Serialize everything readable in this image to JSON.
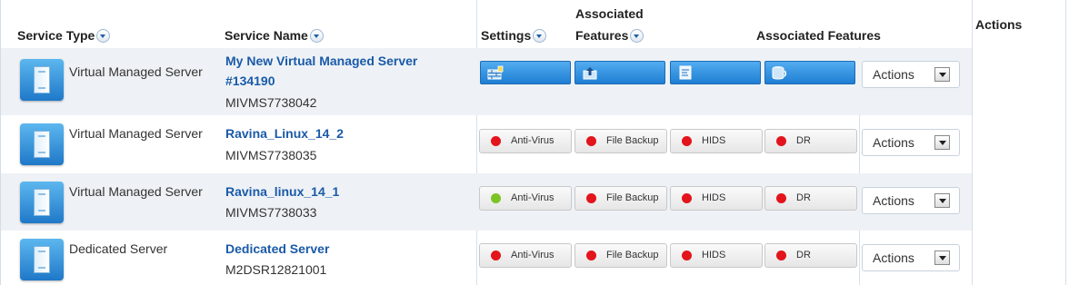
{
  "header": {
    "service_type": "Service Type",
    "service_name": "Service Name",
    "settings": "Settings",
    "associated_features_1": "Associated",
    "associated_features_2": "Features",
    "associated_features_full": "Associated Features",
    "actions": "Actions"
  },
  "rows": [
    {
      "type": "Virtual Managed Server",
      "name_line1": "My New Virtual Managed Server",
      "name_line2": "#134190",
      "code": "MIVMS7738042",
      "action": "Actions"
    },
    {
      "type": "Virtual Managed Server",
      "name_line1": "Ravina_Linux_14_2",
      "code": "MIVMS7738035",
      "action": "Actions",
      "features": [
        {
          "label": "Anti-Virus",
          "status": "red"
        },
        {
          "label": "File Backup",
          "status": "red"
        },
        {
          "label": "HIDS",
          "status": "red"
        },
        {
          "label": "DR",
          "status": "red"
        }
      ]
    },
    {
      "type": "Virtual Managed Server",
      "name_line1": "Ravina_linux_14_1",
      "code": "MIVMS7738033",
      "action": "Actions",
      "features": [
        {
          "label": "Anti-Virus",
          "status": "green"
        },
        {
          "label": "File Backup",
          "status": "red"
        },
        {
          "label": "HIDS",
          "status": "red"
        },
        {
          "label": "DR",
          "status": "red"
        }
      ]
    },
    {
      "type": "Dedicated Server",
      "name_line1": "Dedicated Server",
      "code": "M2DSR12821001",
      "action": "Actions",
      "features": [
        {
          "label": "Anti-Virus",
          "status": "red"
        },
        {
          "label": "File Backup",
          "status": "red"
        },
        {
          "label": "HIDS",
          "status": "red"
        },
        {
          "label": "DR",
          "status": "red"
        }
      ]
    }
  ],
  "colors": {
    "red": "#e3141b",
    "green": "#7cc425"
  },
  "icons": [
    "firewall-lock-icon",
    "backup-upload-icon",
    "monitor-icon",
    "database-sync-icon"
  ]
}
